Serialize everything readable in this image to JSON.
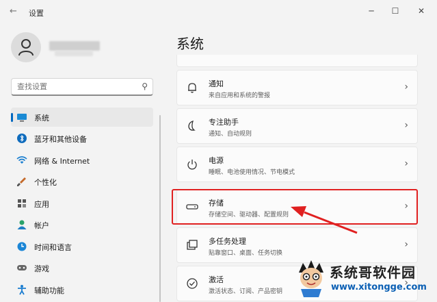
{
  "window": {
    "title": "设置"
  },
  "search": {
    "placeholder": "查找设置"
  },
  "sidebar": {
    "items": [
      {
        "label": "系统",
        "icon": "monitor-icon",
        "active": true
      },
      {
        "label": "蓝牙和其他设备",
        "icon": "bluetooth-icon"
      },
      {
        "label": "网络 & Internet",
        "icon": "wifi-icon"
      },
      {
        "label": "个性化",
        "icon": "brush-icon"
      },
      {
        "label": "应用",
        "icon": "apps-icon"
      },
      {
        "label": "帐户",
        "icon": "person-icon"
      },
      {
        "label": "时间和语言",
        "icon": "globe-clock-icon"
      },
      {
        "label": "游戏",
        "icon": "game-icon"
      },
      {
        "label": "辅助功能",
        "icon": "accessibility-icon"
      }
    ]
  },
  "main": {
    "title": "系统",
    "cards": [
      {
        "title": "通知",
        "subtitle": "来自应用和系统的警报",
        "icon": "bell-icon"
      },
      {
        "title": "专注助手",
        "subtitle": "通知、自动规则",
        "icon": "moon-icon"
      },
      {
        "title": "电源",
        "subtitle": "睡眠、电池使用情况、节电模式",
        "icon": "power-icon"
      },
      {
        "title": "存储",
        "subtitle": "存储空间、驱动器、配置规则",
        "icon": "storage-icon"
      },
      {
        "title": "多任务处理",
        "subtitle": "贴靠窗口、桌面、任务切换",
        "icon": "multitask-icon"
      },
      {
        "title": "激活",
        "subtitle": "激活状态、订阅、产品密钥",
        "icon": "check-circle-icon"
      }
    ]
  },
  "watermark": {
    "main": "系统哥软件园",
    "url": "www.xitongge.com"
  },
  "colors": {
    "accent": "#0067c0",
    "annotation": "#e02020"
  }
}
